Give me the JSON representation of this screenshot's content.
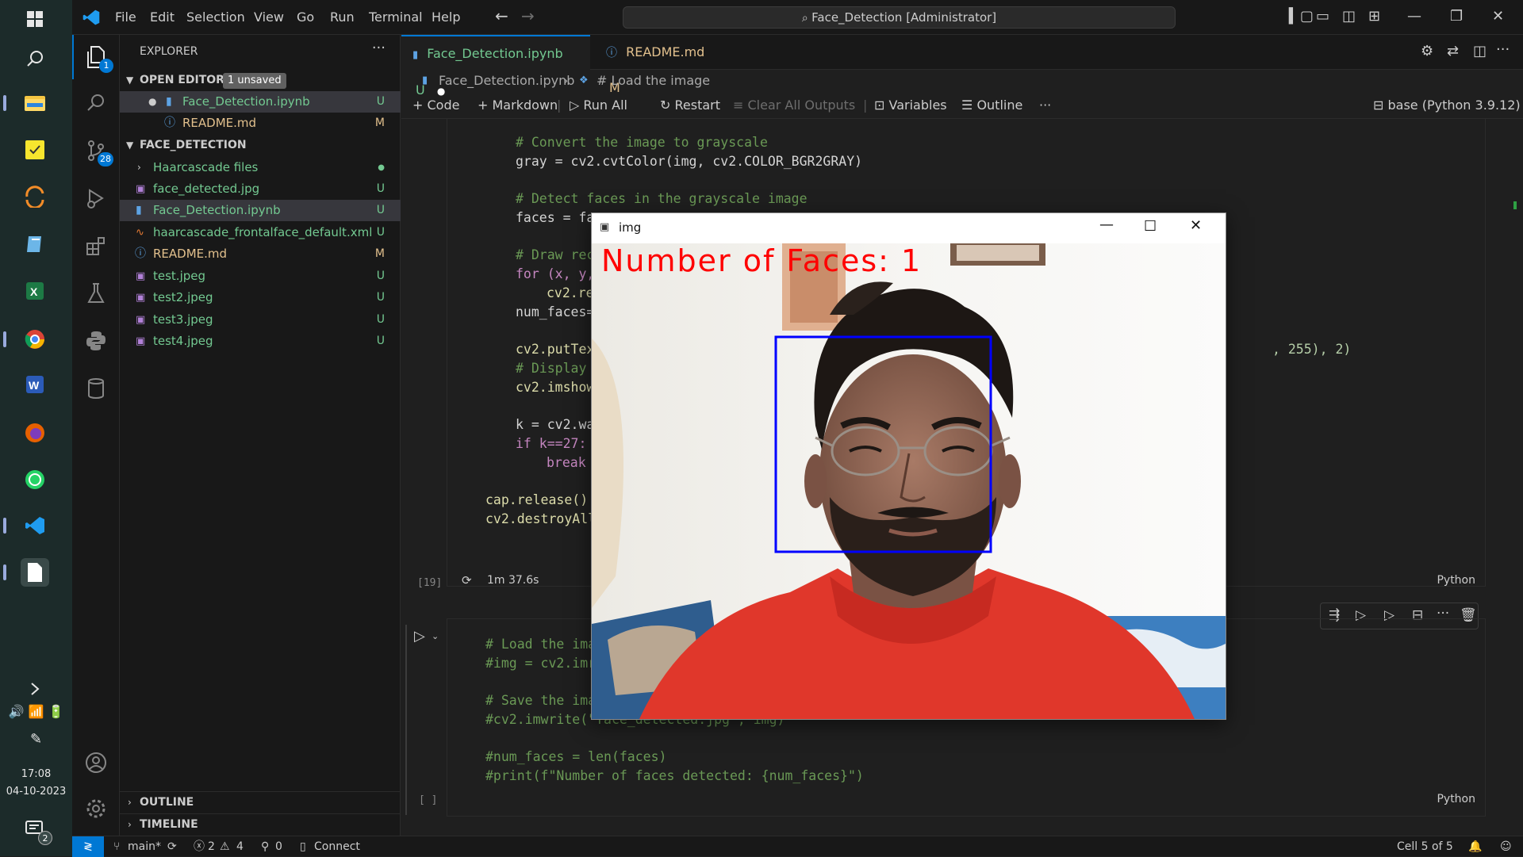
{
  "taskbar": {
    "apps": [
      "windows-start",
      "search",
      "file-explorer",
      "sticky-notes",
      "anaconda",
      "notepad",
      "excel",
      "chrome",
      "word",
      "firefox",
      "whatsapp",
      "vscode",
      "notepad-file"
    ],
    "time": "17:08",
    "date": "04-10-2023",
    "notification_count": "2"
  },
  "titlebar": {
    "menus": [
      "File",
      "Edit",
      "Selection",
      "View",
      "Go",
      "Run",
      "Terminal",
      "Help"
    ],
    "command_center": "Face_Detection [Administrator]"
  },
  "activity": {
    "explorer_badge": "1",
    "scm_badge": "28"
  },
  "explorer": {
    "title": "EXPLORER",
    "open_editors_label": "OPEN EDITORS",
    "unsaved_badge": "1 unsaved",
    "open_editors": [
      {
        "name": "Face_Detection.ipynb",
        "status": "U"
      },
      {
        "name": "README.md",
        "status": "M"
      }
    ],
    "folder_label": "FACE_DETECTION",
    "files": [
      {
        "name": "Haarcascade files",
        "status": "●",
        "type": "folder"
      },
      {
        "name": "face_detected.jpg",
        "status": "U",
        "type": "image"
      },
      {
        "name": "Face_Detection.ipynb",
        "status": "U",
        "type": "notebook"
      },
      {
        "name": "haarcascade_frontalface_default.xml",
        "status": "U",
        "type": "xml"
      },
      {
        "name": "README.md",
        "status": "M",
        "type": "info"
      },
      {
        "name": "test.jpeg",
        "status": "U",
        "type": "image"
      },
      {
        "name": "test2.jpeg",
        "status": "U",
        "type": "image"
      },
      {
        "name": "test3.jpeg",
        "status": "U",
        "type": "image"
      },
      {
        "name": "test4.jpeg",
        "status": "U",
        "type": "image"
      }
    ],
    "outline_label": "OUTLINE",
    "timeline_label": "TIMELINE"
  },
  "tabs": [
    {
      "name": "Face_Detection.ipynb",
      "status": "U"
    },
    {
      "name": "README.md",
      "status": "M"
    }
  ],
  "breadcrumb": {
    "file": "Face_Detection.ipynb",
    "section": "# Load the image"
  },
  "toolbar": {
    "code": "Code",
    "markdown": "Markdown",
    "run_all": "Run All",
    "restart": "Restart",
    "clear_outputs": "Clear All Outputs",
    "variables": "Variables",
    "outline": "Outline",
    "kernel": "base (Python 3.9.12)"
  },
  "cell1": {
    "lines": [
      "# Convert the image to grayscale",
      "gray = cv2.cvtColor(img, cv2.COLOR_BGR2GRAY)",
      "# Detect faces in the grayscale image",
      "faces = fac",
      "# Draw rect",
      "for (x, y,",
      "cv2.rec",
      "num_faces=l",
      "cv2.putText",
      ", 255), 2)",
      "# Display t",
      "cv2.imshow(",
      "k = cv2.wai",
      "if k==27:",
      "break",
      "cap.release()",
      "cv2.destroyAllW"
    ],
    "exec_count": "[19]",
    "duration": "1m 37.6s",
    "language": "Python"
  },
  "cell2": {
    "lines": [
      "# Load the imag",
      "#img = cv2.imre",
      "# Save the imag",
      "#cv2.imwrite(\"face_detected.jpg\", img)",
      "#num_faces = len(faces)",
      "#print(f\"Number of faces detected: {num_faces}\")"
    ],
    "exec_count": "[ ]",
    "language": "Python"
  },
  "image_window": {
    "title": "img",
    "overlay_text": "Number of Faces: 1"
  },
  "statusbar": {
    "branch": "main*",
    "errors": "2",
    "warnings": "4",
    "ports": "0",
    "connect": "Connect",
    "cell_position": "Cell 5 of 5"
  }
}
